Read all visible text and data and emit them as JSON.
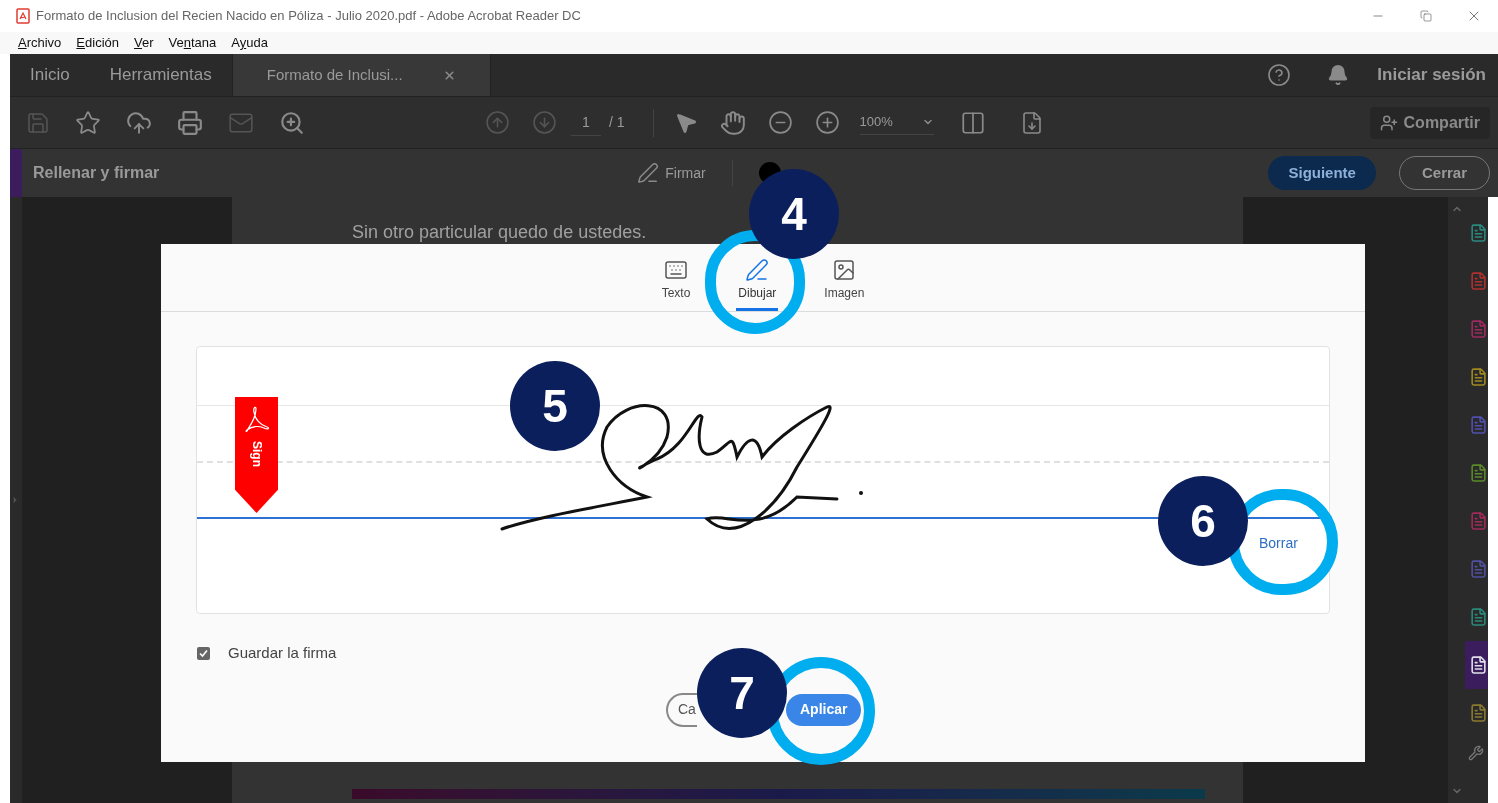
{
  "window": {
    "title": "Formato de Inclusion del Recien Nacido en Póliza - Julio 2020.pdf - Adobe Acrobat Reader DC"
  },
  "menu": [
    {
      "key": "A",
      "post": "rchivo"
    },
    {
      "key": "E",
      "post": "dición"
    },
    {
      "key": "V",
      "post": "er"
    },
    {
      "pre": "Ve",
      "key": "n",
      "post": "tana"
    },
    {
      "pre": "A",
      "key": "y",
      "post": "uda"
    }
  ],
  "tabs": [
    {
      "label": "Inicio",
      "selected": false,
      "closable": false
    },
    {
      "label": "Herramientas",
      "selected": false,
      "closable": false
    },
    {
      "label": "Formato de Inclusi...",
      "selected": true,
      "closable": true
    }
  ],
  "account": {
    "sign_in": "Iniciar sesión"
  },
  "toolbar": {
    "page": "1",
    "page_total": "/ 1",
    "zoom": "100%",
    "share": "Compartir"
  },
  "fill_sign_bar": {
    "title": "Rellenar y firmar",
    "sign": "Firmar",
    "next": "Siguiente",
    "close": "Cerrar"
  },
  "document": {
    "text": "Sin otro particular quedo de ustedes."
  },
  "dialog": {
    "tabs": [
      {
        "label": "Texto",
        "kind": "keyboard",
        "selected": false
      },
      {
        "label": "Dibujar",
        "kind": "draw",
        "selected": true
      },
      {
        "label": "Imagen",
        "kind": "image",
        "selected": false
      }
    ],
    "flag": "Sign",
    "clear": "Borrar",
    "save_signature": {
      "label": "Guardar la firma",
      "checked": true
    },
    "cancel": "Ca",
    "apply": "Aplicar"
  },
  "callouts": [
    "4",
    "5",
    "6",
    "7"
  ],
  "right_tools": [
    {
      "color": "#2a8a80",
      "selected": false
    },
    {
      "color": "#b03030",
      "selected": false
    },
    {
      "color": "#a02a60",
      "selected": false
    },
    {
      "color": "#a08a20",
      "selected": false
    },
    {
      "color": "#5050b0",
      "selected": false
    },
    {
      "color": "#5a8a2a",
      "selected": false
    },
    {
      "color": "#a02a5a",
      "selected": false
    },
    {
      "color": "#5050a0",
      "selected": false
    },
    {
      "color": "#2a8a7a",
      "selected": false
    },
    {
      "color": "#e0e0ea",
      "selected": true
    },
    {
      "color": "#8a7a30",
      "selected": false
    }
  ]
}
